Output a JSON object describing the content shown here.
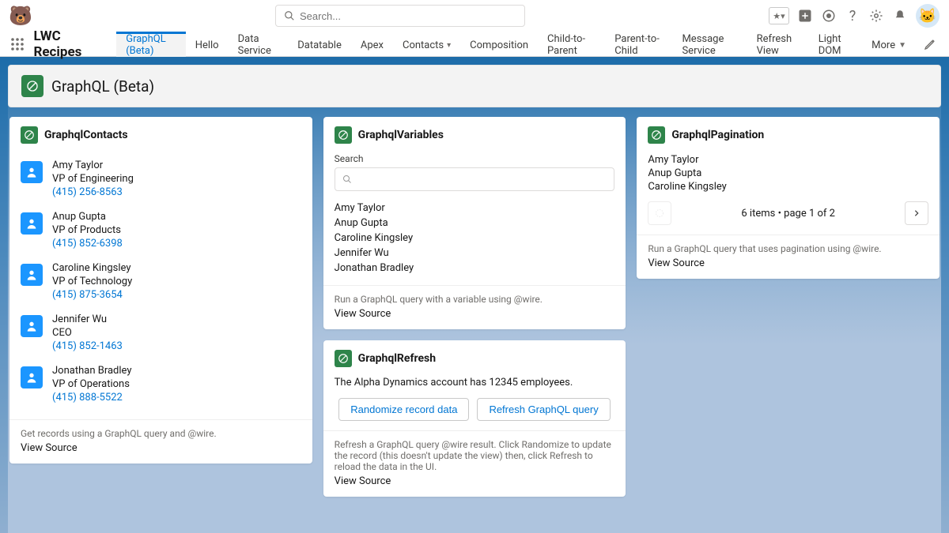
{
  "header": {
    "search_placeholder": "Search..."
  },
  "nav": {
    "app_name": "LWC Recipes",
    "tabs": [
      {
        "label": "GraphQL (Beta)",
        "active": true
      },
      {
        "label": "Hello"
      },
      {
        "label": "Data Service"
      },
      {
        "label": "Datatable"
      },
      {
        "label": "Apex"
      },
      {
        "label": "Contacts",
        "dropdown": true
      },
      {
        "label": "Composition"
      },
      {
        "label": "Child-to-Parent"
      },
      {
        "label": "Parent-to-Child"
      },
      {
        "label": "Message Service"
      },
      {
        "label": "Refresh View"
      },
      {
        "label": "Light DOM"
      }
    ],
    "more_label": "More"
  },
  "page": {
    "title": "GraphQL (Beta)"
  },
  "cards": {
    "contacts": {
      "title": "GraphqlContacts",
      "rows": [
        {
          "name": "Amy Taylor",
          "title": "VP of Engineering",
          "phone": "(415) 256-8563"
        },
        {
          "name": "Anup Gupta",
          "title": "VP of Products",
          "phone": "(415) 852-6398"
        },
        {
          "name": "Caroline Kingsley",
          "title": "VP of Technology",
          "phone": "(415) 875-3654"
        },
        {
          "name": "Jennifer Wu",
          "title": "CEO",
          "phone": "(415) 852-1463"
        },
        {
          "name": "Jonathan Bradley",
          "title": "VP of Operations",
          "phone": "(415) 888-5522"
        }
      ],
      "footer_desc": "Get records using a GraphQL query and @wire.",
      "view_source": "View Source"
    },
    "variables": {
      "title": "GraphqlVariables",
      "search_label": "Search",
      "names": [
        "Amy Taylor",
        "Anup Gupta",
        "Caroline Kingsley",
        "Jennifer Wu",
        "Jonathan Bradley"
      ],
      "footer_desc": "Run a GraphQL query with a variable using @wire.",
      "view_source": "View Source"
    },
    "refresh": {
      "title": "GraphqlRefresh",
      "body": "The Alpha Dynamics account has 12345 employees.",
      "btn1": "Randomize record data",
      "btn2": "Refresh GraphQL query",
      "footer_desc": "Refresh a GraphQL query @wire result. Click Randomize to update the record (this doesn't update the view) then, click Refresh to reload the data in the UI.",
      "view_source": "View Source"
    },
    "pagination": {
      "title": "GraphqlPagination",
      "names": [
        "Amy Taylor",
        "Anup Gupta",
        "Caroline Kingsley"
      ],
      "status": "6 items • page 1 of 2",
      "footer_desc": "Run a GraphQL query that uses pagination using @wire.",
      "view_source": "View Source"
    }
  }
}
